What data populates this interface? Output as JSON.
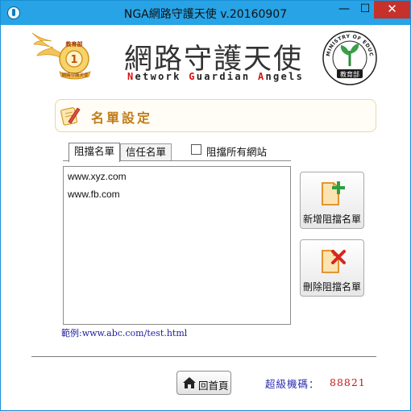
{
  "window": {
    "title": "NGA網路守護天使 v.20160907",
    "minimize_glyph": "—",
    "maximize_glyph": "☐",
    "close_glyph": "✕"
  },
  "header": {
    "app_title": "網路守護天使",
    "subtitle_parts": [
      "N",
      "etwork ",
      "G",
      "uardian ",
      "A",
      "ngels"
    ],
    "badge_text": "教育部",
    "badge_ribbon": "網路守護天使",
    "moe_text": "MINISTRY OF EDUCATION",
    "moe_bottom": "教育部"
  },
  "section": {
    "title": "名單設定",
    "icon": "edit-note-icon"
  },
  "tabs": [
    {
      "label": "阻擋名單",
      "active": true
    },
    {
      "label": "信任名單",
      "active": false
    }
  ],
  "block_all": {
    "label": "阻擋所有網站",
    "checked": false
  },
  "block_list": [
    "www.xyz.com",
    "www.fb.com"
  ],
  "actions": {
    "add_label": "新增阻擋名單",
    "delete_label": "刪除阻擋名單"
  },
  "example_text": "範例:www.abc.com/test.html",
  "footer": {
    "home_label": "回首頁",
    "code_label": "超級機碼：",
    "code_value": "88821"
  },
  "colors": {
    "titlebar": "#27a3e6",
    "close": "#c7312b",
    "section_title": "#c07d1a",
    "code_label": "#2b2bb0",
    "code_value": "#c41919"
  }
}
